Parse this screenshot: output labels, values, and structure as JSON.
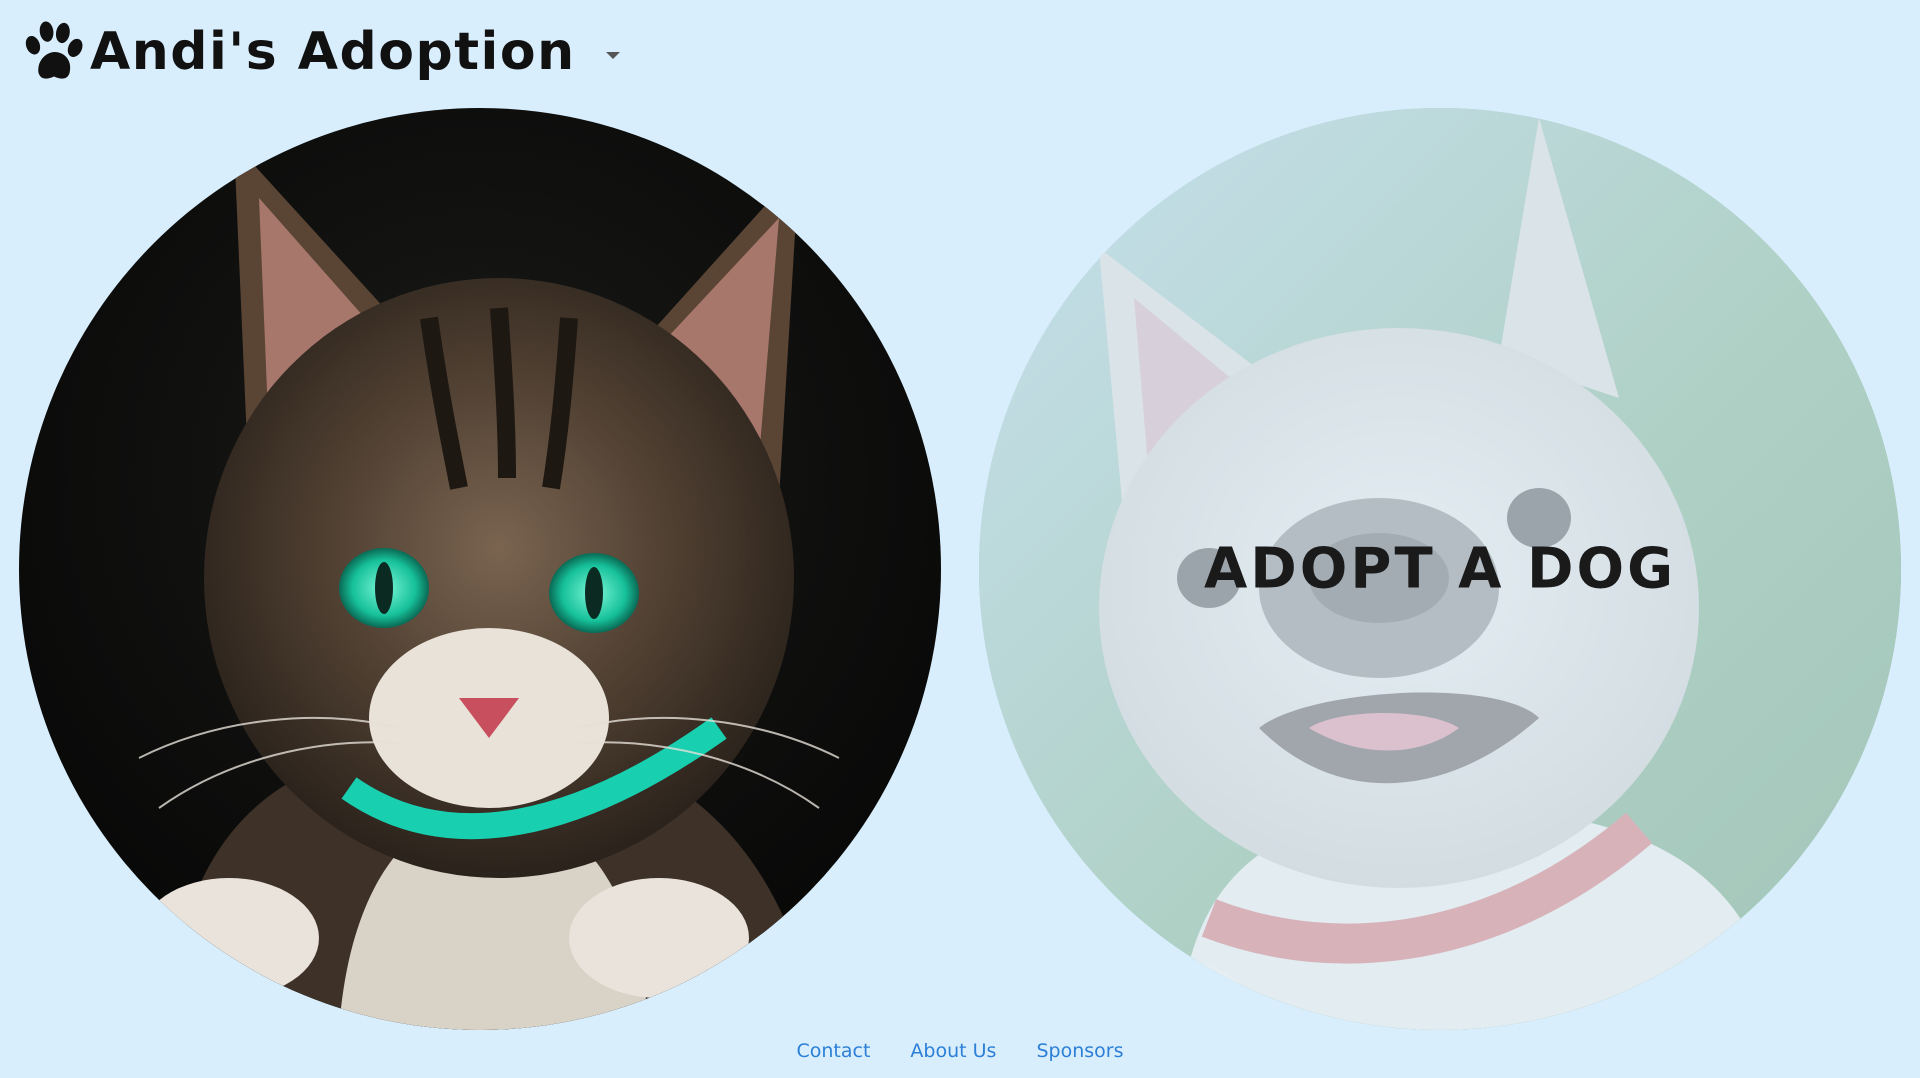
{
  "brand": {
    "icon": "paw-icon",
    "title": "Andi's Adoption",
    "dropdown_icon": "caret-down-icon"
  },
  "cards": [
    {
      "name": "cat",
      "image": "tabby cat with green eyes",
      "label": ""
    },
    {
      "name": "dog",
      "image": "french bulldog",
      "label": "ADOPT A DOG"
    }
  ],
  "footer": {
    "links": [
      "Contact",
      "About Us",
      "Sponsors"
    ]
  },
  "colors": {
    "background": "#d9eefc",
    "link": "#2b7fd6",
    "text": "#111111"
  }
}
